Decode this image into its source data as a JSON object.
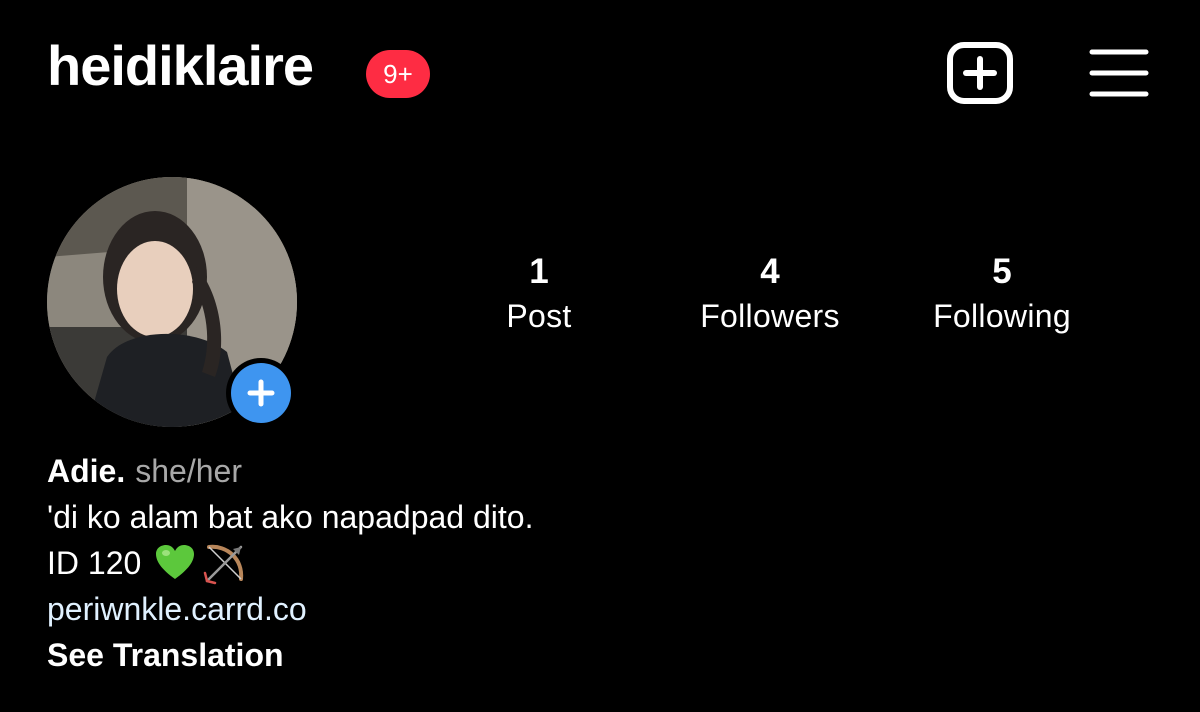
{
  "header": {
    "username": "heidiklaire",
    "notification_badge": "9+",
    "new_post_icon": "plus-square-icon",
    "menu_icon": "hamburger-menu-icon"
  },
  "profile": {
    "avatar_icon": "add-story-plus-icon",
    "stats": [
      {
        "value": "1",
        "label": "Post"
      },
      {
        "value": "4",
        "label": "Followers"
      },
      {
        "value": "5",
        "label": "Following"
      }
    ],
    "bio": {
      "display_name": "Adie.",
      "pronouns": "she/her",
      "line1": "'di ko alam bat ako napadpad dito.",
      "line2": "ID 120",
      "line2_emojis": [
        "green-heart-icon",
        "bow-and-arrow-icon"
      ],
      "link": "periwnkle.carrd.co",
      "translate": "See Translation"
    }
  },
  "colors": {
    "background": "#000000",
    "text": "#ffffff",
    "muted": "#a8a8a8",
    "badge": "#fe2c43",
    "accent_blue": "#3e95f0",
    "link": "#e0f1ff"
  }
}
